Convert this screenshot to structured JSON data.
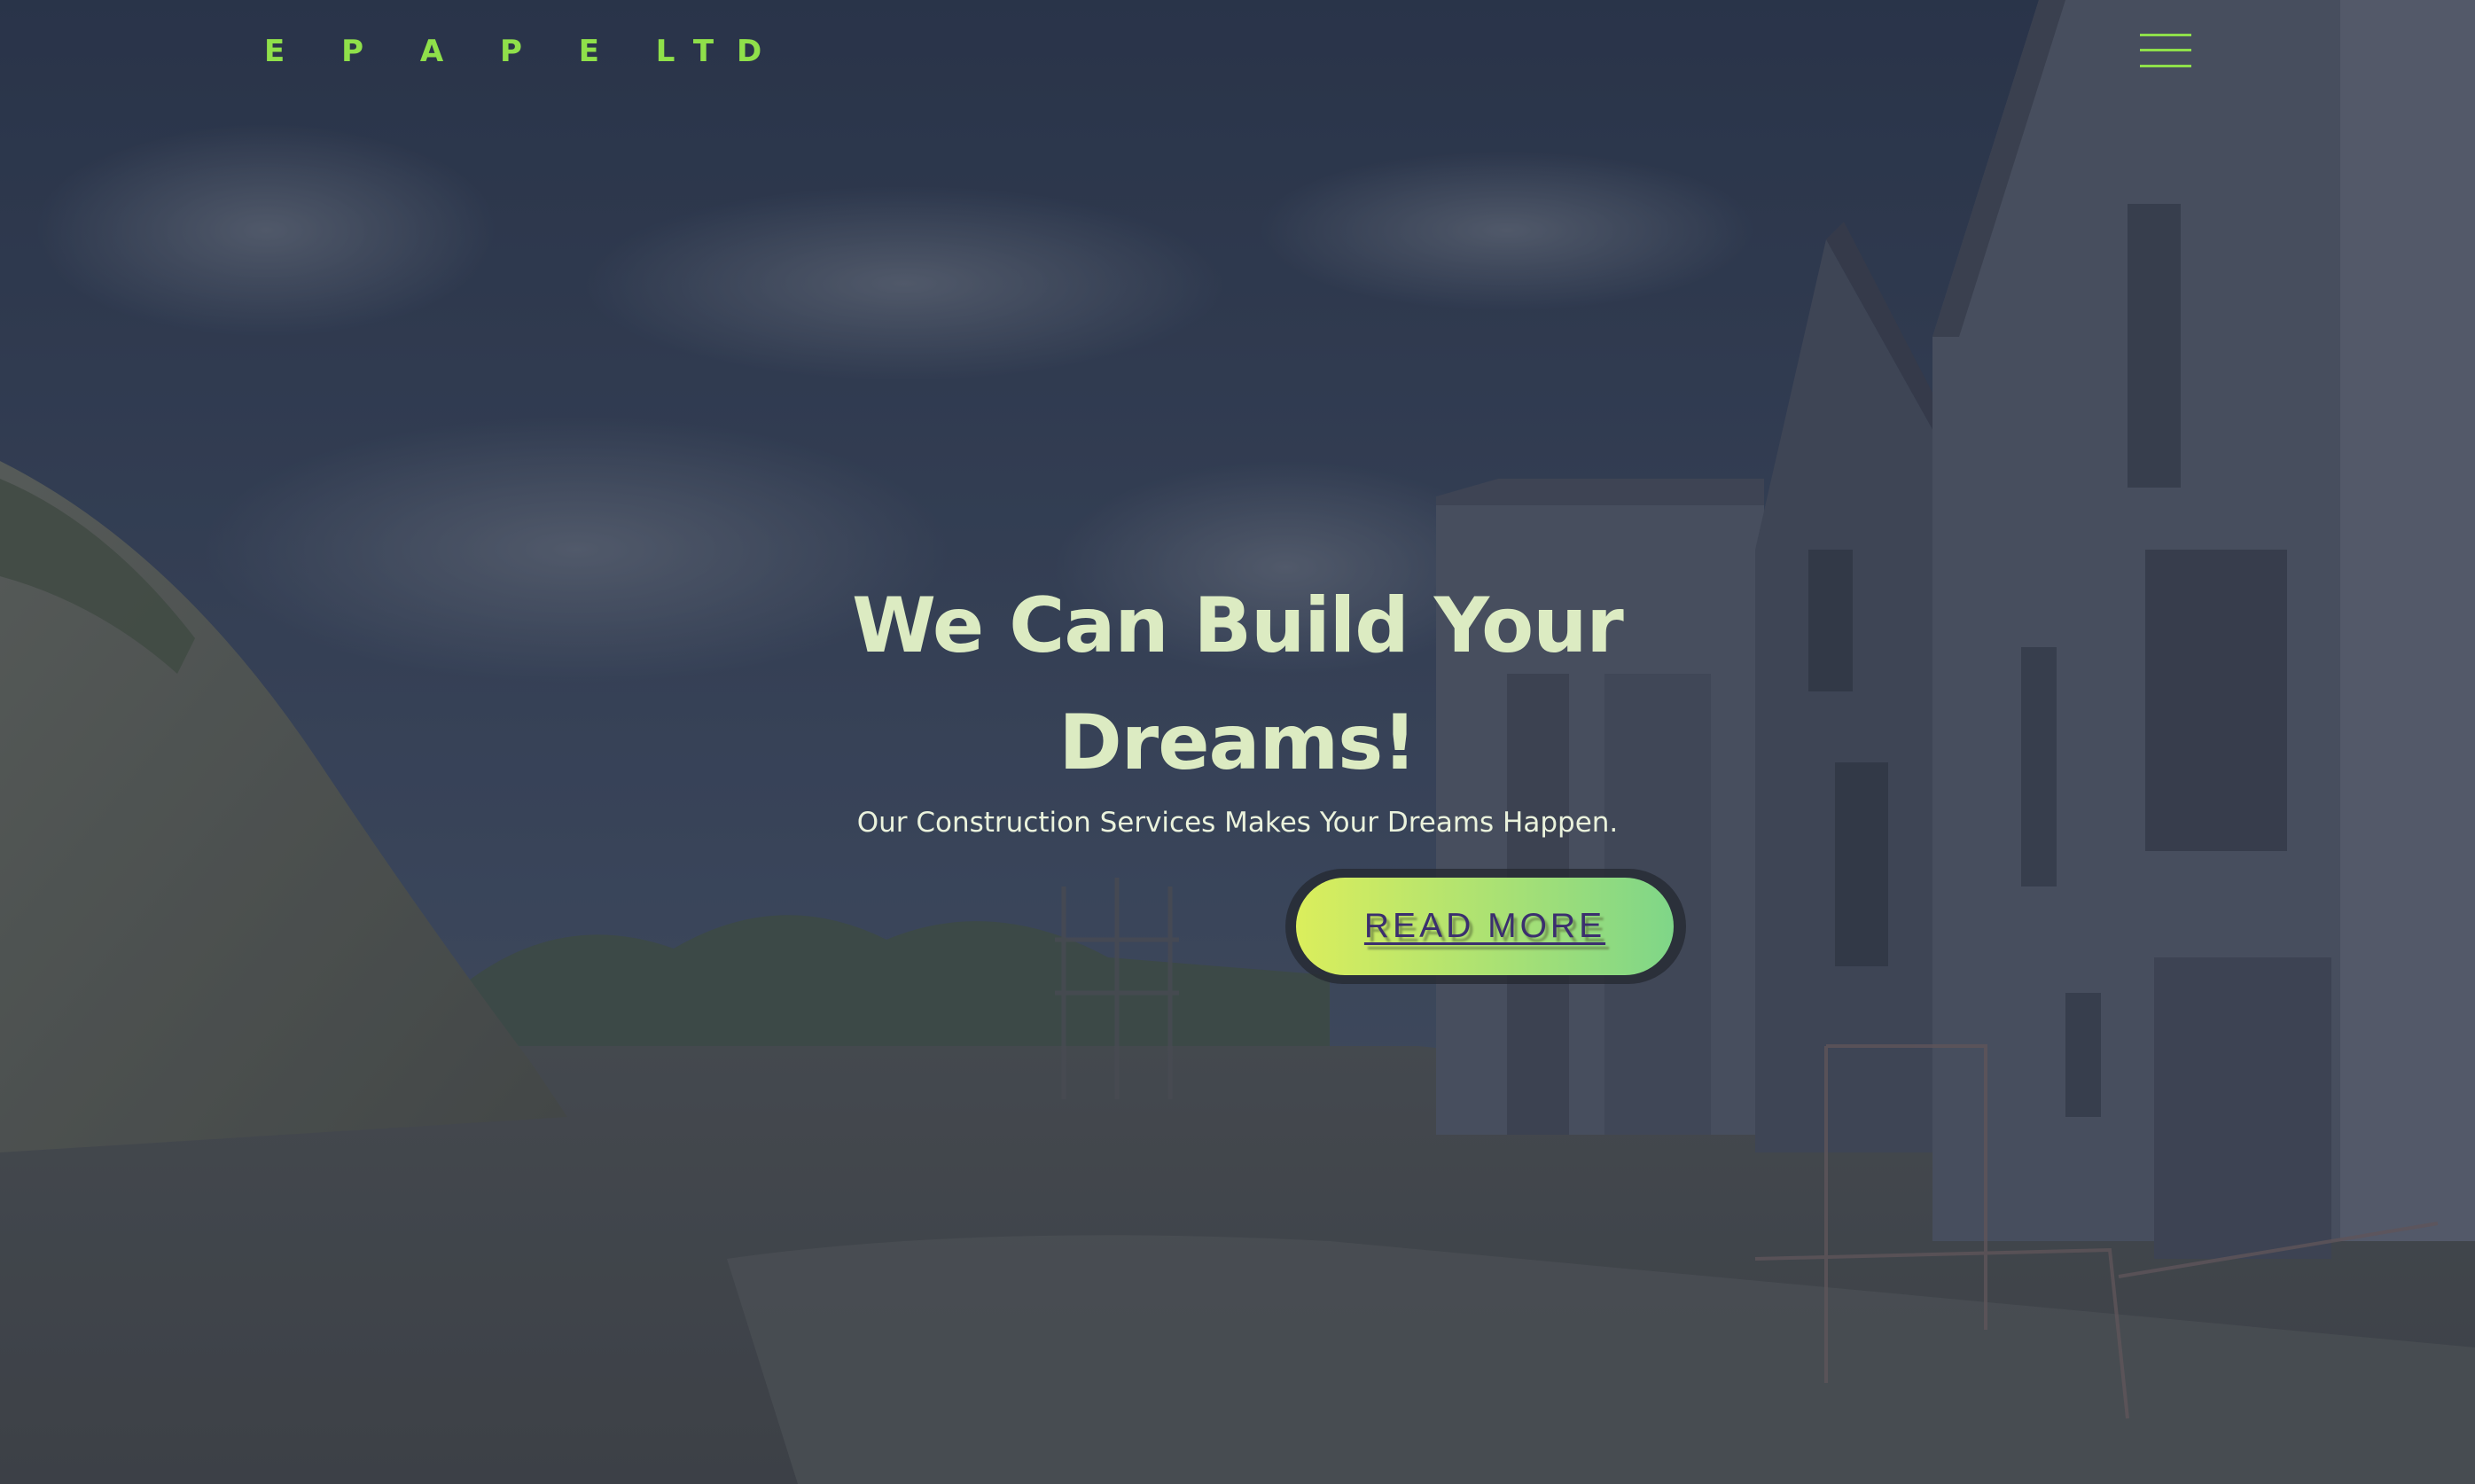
{
  "header": {
    "logo": "E P A P E LTD",
    "menu_icon": "hamburger-menu-icon"
  },
  "hero": {
    "headline_line1": "We Can Build Your",
    "headline_line2": "Dreams!",
    "subtitle": "Our Construction Services Makes Your Dreams Happen.",
    "cta_label": "READ MORE"
  },
  "colors": {
    "accent_green": "#8fe04a",
    "headline": "#dcebc2",
    "subtitle": "#eaf2dc",
    "cta_gradient_start": "#dbee5c",
    "cta_gradient_end": "#7fd688",
    "cta_text": "#3b2f6e",
    "menu_icon": "#8fe04a"
  },
  "background": {
    "description_icon": "construction-site-photo"
  }
}
